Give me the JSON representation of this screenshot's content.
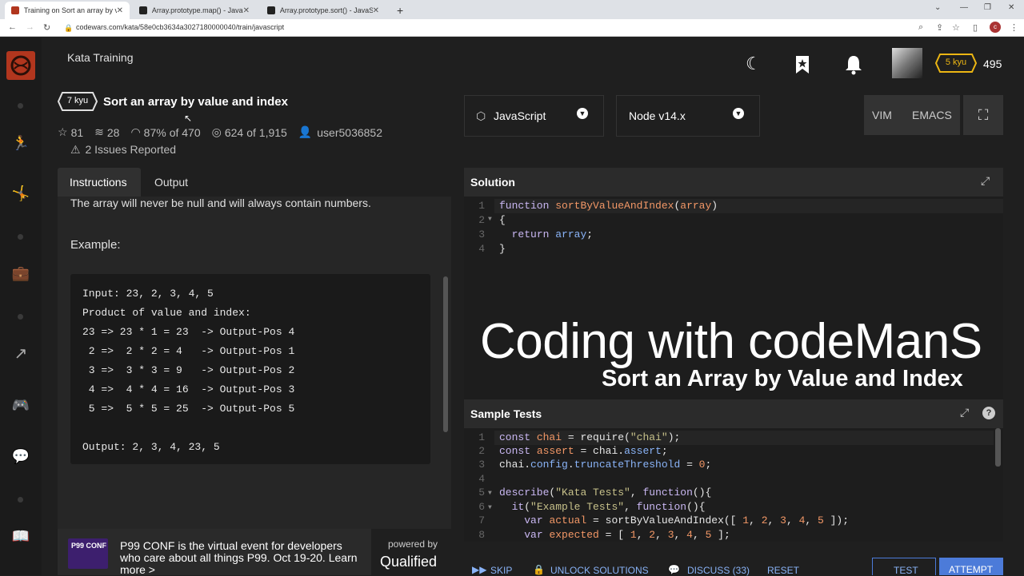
{
  "browser": {
    "tabs": [
      {
        "label": "Training on Sort an array by valu",
        "color": "#b1361e"
      },
      {
        "label": "Array.prototype.map() - JavaScript",
        "color": "#333"
      },
      {
        "label": "Array.prototype.sort() - JavaScript",
        "color": "#333"
      }
    ],
    "new_tab": "+",
    "url": "codewars.com/kata/58e0cb3634a3027180000040/train/javascript"
  },
  "header": {
    "section": "Kata Training",
    "rank": "5 kyu",
    "honor": "495"
  },
  "kata": {
    "kyu": "7 kyu",
    "title": "Sort an array by value and index",
    "stars": "81",
    "collections": "28",
    "satisfaction_pct": "87%",
    "satisfaction_of": "of 470",
    "completed": "624",
    "completed_of": "of 1,915",
    "author": "user5036852",
    "issues": "2 Issues Reported"
  },
  "tabs": {
    "instructions": "Instructions",
    "output": "Output"
  },
  "description": {
    "partial_line": "The array will never be null and will always contain numbers.",
    "example_heading": "Example:",
    "example_lines": [
      "Input: 23, 2, 3, 4, 5",
      "Product of value and index:",
      "23 => 23 * 1 = 23  -> Output-Pos 4",
      " 2 =>  2 * 2 = 4   -> Output-Pos 1",
      " 3 =>  3 * 3 = 9   -> Output-Pos 2",
      " 4 =>  4 * 4 = 16  -> Output-Pos 3",
      " 5 =>  5 * 5 = 25  -> Output-Pos 5",
      "",
      "Output: 2, 3, 4, 23, 5"
    ]
  },
  "ad": {
    "logo": "P99 CONF",
    "text": "P99 CONF is the virtual event for developers who care about all things P99. Oct 19-20. Learn more >",
    "powered_by": "powered by",
    "brand": "Qualified"
  },
  "editor": {
    "language": "JavaScript",
    "runtime": "Node v14.x",
    "mode_vim": "VIM",
    "mode_emacs": "EMACS",
    "solution_title": "Solution",
    "tests_title": "Sample Tests",
    "solution_line_numbers": [
      "1",
      "2",
      "3",
      "4"
    ],
    "test_line_numbers": [
      "1",
      "2",
      "3",
      "4",
      "5",
      "6",
      "7",
      "8"
    ]
  },
  "overlay": {
    "title": "Coding with codeManS",
    "subtitle": "Sort an Array by Value and Index"
  },
  "footer": {
    "skip": "SKIP",
    "unlock": "UNLOCK SOLUTIONS",
    "discuss": "DISCUSS (33)",
    "reset": "RESET",
    "test": "TEST",
    "attempt": "ATTEMPT"
  },
  "colors": {
    "accent": "#b1361e",
    "rank_yellow": "#ecb613",
    "attempt_blue": "#4c7bd9"
  }
}
